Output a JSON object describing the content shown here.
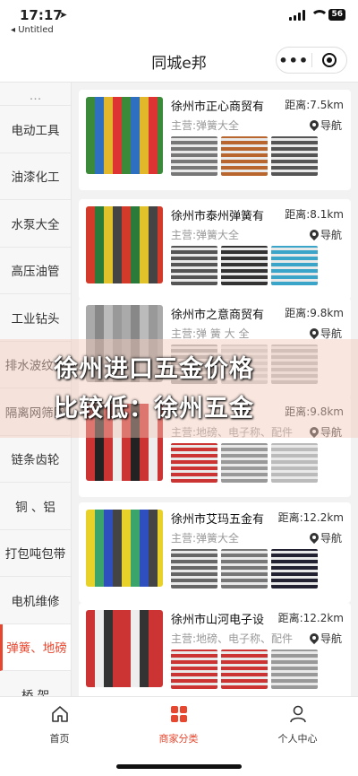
{
  "status_bar": {
    "time": "17:17",
    "back_app": "◂ Untitled",
    "battery": "56"
  },
  "nav": {
    "title": "同城e邦",
    "more_icon": "more-dots-icon",
    "close_icon": "mini-program-close-icon"
  },
  "sidebar": {
    "items": [
      {
        "label": "电动工具",
        "active": false
      },
      {
        "label": "油漆化工",
        "active": false
      },
      {
        "label": "水泵大全",
        "active": false
      },
      {
        "label": "高压油管",
        "active": false
      },
      {
        "label": "工业钻头",
        "active": false
      },
      {
        "label": "排水波纹管",
        "active": false
      },
      {
        "label": "隔离网筛网",
        "active": false
      },
      {
        "label": "链条齿轮",
        "active": false
      },
      {
        "label": "铜 、铝",
        "active": false
      },
      {
        "label": "打包吨包带",
        "active": false
      },
      {
        "label": "电机维修",
        "active": false
      },
      {
        "label": "弹簧、地磅",
        "active": true
      },
      {
        "label": "桥 架",
        "active": false
      }
    ]
  },
  "shops": [
    {
      "name": "徐州市正心商贸有",
      "distance": "距离:7.5km",
      "business": "主营:弹簧大全",
      "nav_label": "导航",
      "thumb_colors": [
        "#3a8a3a",
        "#2f6fbf",
        "#e2b72a",
        "#d33"
      ],
      "product_colors": [
        "#777",
        "#b9652e",
        "#555"
      ]
    },
    {
      "name": "徐州市泰州弹簧有",
      "distance": "距离:8.1km",
      "business": "主营:弹簧大全",
      "nav_label": "导航",
      "thumb_colors": [
        "#d43a2a",
        "#2a7a3a",
        "#e2c22a",
        "#444"
      ],
      "product_colors": [
        "#555",
        "#333",
        "#3aa4c9"
      ]
    },
    {
      "name": "徐州市之意商贸有",
      "distance": "距离:9.8km",
      "business": "主营:弹 簧 大 全",
      "nav_label": "导航",
      "thumb_colors": [
        "#aaa",
        "#888",
        "#bbb",
        "#999"
      ],
      "product_colors": [
        "#aaa",
        "#ccc",
        "#bbb"
      ]
    },
    {
      "name": "",
      "distance": "距离:9.8km",
      "business": "主营:地磅、电子称、配件",
      "nav_label": "导航",
      "thumb_colors": [
        "#c33",
        "#222",
        "#c33",
        "#eee"
      ],
      "product_colors": [
        "#c33",
        "#999",
        "#bbb"
      ]
    },
    {
      "name": "徐州市艾玛五金有",
      "distance": "距离:12.2km",
      "business": "主营:弹簧大全",
      "nav_label": "导航",
      "thumb_colors": [
        "#e8d22a",
        "#3aa46a",
        "#2f4fbf",
        "#444"
      ],
      "product_colors": [
        "#666",
        "#777",
        "#223"
      ]
    },
    {
      "name": "徐州市山河电子设",
      "distance": "距离:12.2km",
      "business": "主营:地磅、电子称、配件",
      "nav_label": "导航",
      "thumb_colors": [
        "#c33",
        "#eee",
        "#333",
        "#c33"
      ],
      "product_colors": [
        "#c33",
        "#c33",
        "#999"
      ]
    }
  ],
  "overlay": {
    "line1": "徐州进口五金价格",
    "line2": "比较低：徐州五金"
  },
  "tabbar": {
    "tabs": [
      {
        "label": "首页",
        "icon": "home-icon",
        "active": false
      },
      {
        "label": "商家分类",
        "icon": "category-grid-icon",
        "active": true
      },
      {
        "label": "个人中心",
        "icon": "person-icon",
        "active": false
      }
    ]
  },
  "colors": {
    "accent": "#e8472f"
  }
}
